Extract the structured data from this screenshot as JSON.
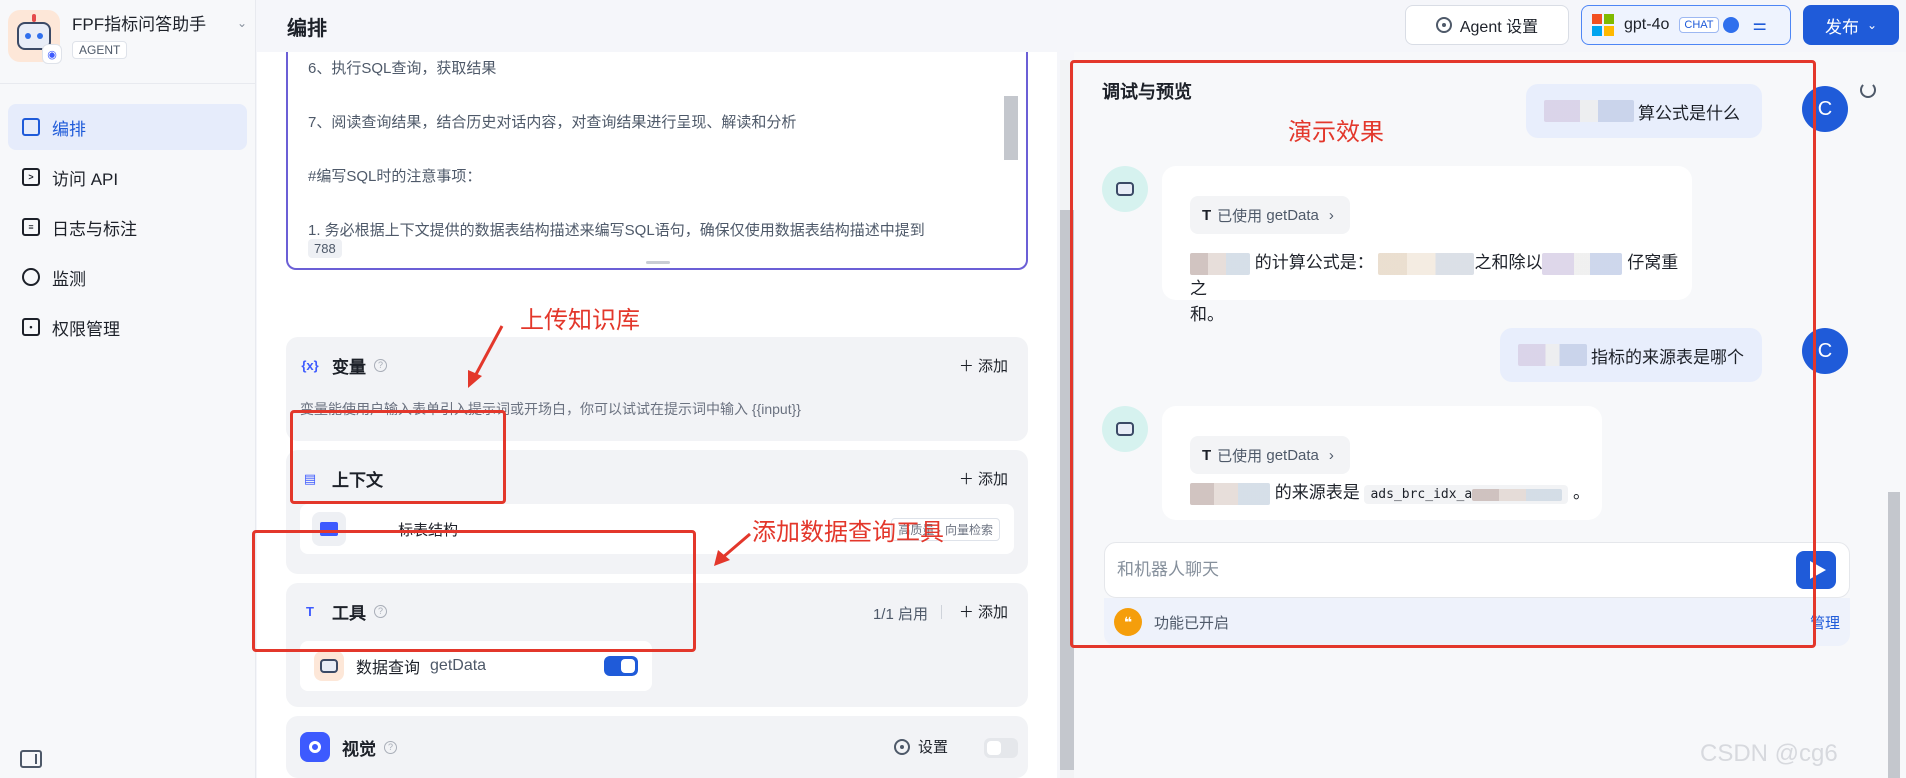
{
  "app": {
    "name": "FPF指标问答助手",
    "tag": "AGENT"
  },
  "sidebar": {
    "items": [
      {
        "label": "编排",
        "icon": "layout-icon",
        "active": true
      },
      {
        "label": "访问 API",
        "icon": "terminal-icon",
        "active": false
      },
      {
        "label": "日志与标注",
        "icon": "document-icon",
        "active": false
      },
      {
        "label": "监测",
        "icon": "gauge-icon",
        "active": false
      },
      {
        "label": "权限管理",
        "icon": "lock-icon",
        "active": false
      }
    ]
  },
  "header": {
    "title": "编排",
    "agent_settings_label": "Agent 设置",
    "model_name": "gpt-4o",
    "model_tag": "CHAT",
    "publish_label": "发布"
  },
  "prompt": {
    "lines": [
      "6、执行SQL查询，获取结果",
      "7、阅读查询结果，结合历史对话内容，对查询结果进行呈现、解读和分析",
      "#编写SQL时的注意事项：",
      "1. 务必根据上下文提供的数据表结构描述来编写SQL语句，确保仅使用数据表结构描述中提到"
    ],
    "char_count": "788"
  },
  "variables": {
    "title": "变量",
    "add_label": "添加",
    "description": "变量能使用户输入表单引入提示词或开场白，你可以试试在提示词中输入 {{input}}"
  },
  "context": {
    "title": "上下文",
    "add_label": "添加",
    "item_name": "标表结构",
    "item_tag": "高质量 · 向量检索"
  },
  "tools": {
    "title": "工具",
    "count": "1/1 启用",
    "add_label": "添加",
    "tool_name": "数据查询",
    "tool_fn": "getData",
    "enabled": true
  },
  "vision": {
    "title": "视觉",
    "settings_label": "设置",
    "enabled": false
  },
  "preview": {
    "title": "调试与预览",
    "messages": [
      {
        "role": "user",
        "text": "算公式是什么",
        "avatar": "C"
      },
      {
        "role": "bot",
        "tool": "getData",
        "tool_prefix": "已使用",
        "text_a": "的计算公式是：",
        "text_b": "之和除以",
        "text_c": "仔窝重之",
        "text_d": "和。"
      },
      {
        "role": "user",
        "text": "指标的来源表是哪个",
        "avatar": "C"
      },
      {
        "role": "bot",
        "tool": "getData",
        "tool_prefix": "已使用",
        "text_a": "的来源表是",
        "code": "ads_brc_idx_a",
        "text_end": "。"
      }
    ],
    "input_placeholder": "和机器人聊天",
    "feature_label": "功能已开启",
    "feature_manage": "管理"
  },
  "annotations": {
    "demo": "演示效果",
    "upload_kb": "上传知识库",
    "add_tool": "添加数据查询工具",
    "color": "#e3372b"
  },
  "watermark": "CSDN @cg6",
  "colors": {
    "primary": "#1f5bd9",
    "accent_purple": "#6b5fd6"
  }
}
